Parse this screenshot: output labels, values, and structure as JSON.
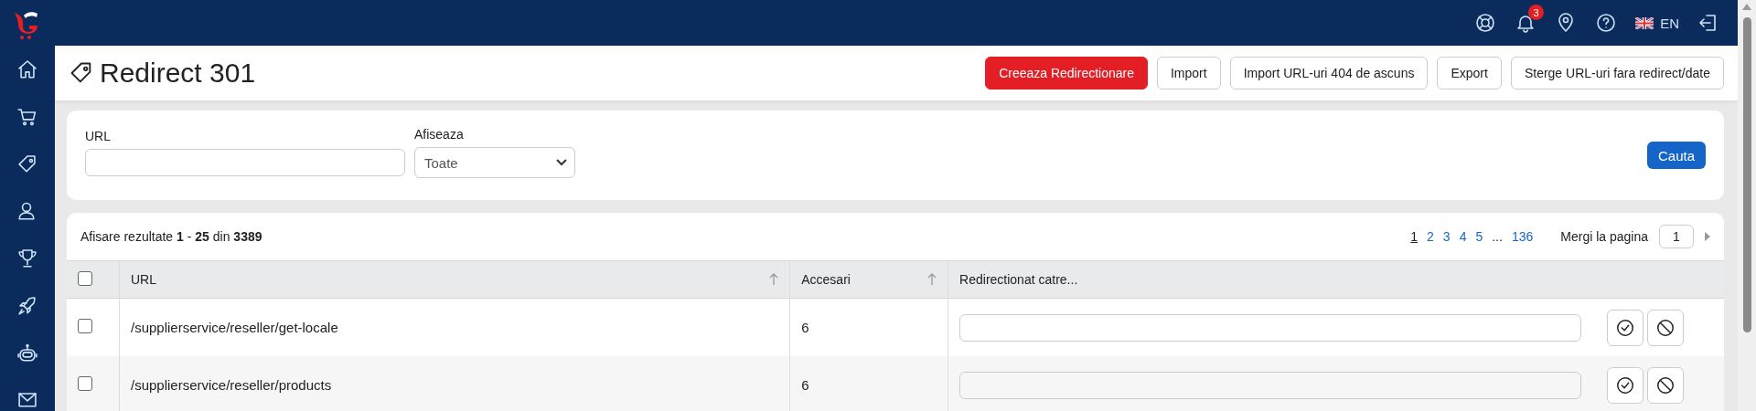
{
  "topbar": {
    "notifications": "3",
    "language": "EN"
  },
  "page": {
    "title": "Redirect 301",
    "actions": [
      {
        "label": "Creeaza Redirectionare",
        "kind": "primary"
      },
      {
        "label": "Import",
        "kind": "default"
      },
      {
        "label": "Import URL-uri 404 de ascuns",
        "kind": "default"
      },
      {
        "label": "Export",
        "kind": "default"
      },
      {
        "label": "Sterge URL-uri fara redirect/date",
        "kind": "default"
      }
    ]
  },
  "filter": {
    "url_label": "URL",
    "show_label": "Afiseaza",
    "show_value": "Toate",
    "search_button": "Cauta"
  },
  "results": {
    "summary": "Afisare rezultate **1** - **25** din **3389**",
    "pages": [
      {
        "label": "1",
        "selected": true
      },
      {
        "label": "2",
        "selected": false
      },
      {
        "label": "3",
        "selected": false
      },
      {
        "label": "4",
        "selected": false
      },
      {
        "label": "5",
        "selected": false
      }
    ],
    "ellipsis": "...",
    "last_page": "136",
    "goto_label": "Mergi la pagina",
    "goto_value": "1"
  },
  "table": {
    "select_all_checked": false,
    "columns": [
      {
        "label": "URL",
        "sortable": true
      },
      {
        "label": "Accesari",
        "sortable": true
      },
      {
        "label": "Redirectionat catre...",
        "sortable": false
      }
    ],
    "rows": [
      {
        "checked": false,
        "url": "/supplierservice/reseller/get-locale",
        "hits": "6"
      },
      {
        "checked": false,
        "url": "/supplierservice/reseller/products",
        "hits": "6"
      }
    ]
  }
}
